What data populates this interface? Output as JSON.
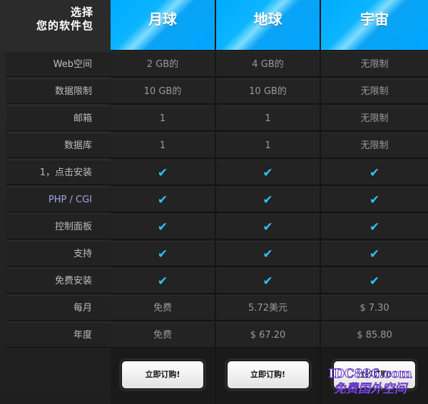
{
  "corner": {
    "line1": "选择",
    "line2": "您的软件包"
  },
  "plans": [
    {
      "name": "月球"
    },
    {
      "name": "地球"
    },
    {
      "name": "宇宙"
    }
  ],
  "rows": [
    {
      "label": "Web空间",
      "values": [
        "2 GB的",
        "4 GB的",
        "无限制"
      ]
    },
    {
      "label": "数据限制",
      "values": [
        "10 GB的",
        "10 GB的",
        "无限制"
      ]
    },
    {
      "label": "邮箱",
      "values": [
        "1",
        "1",
        "无限制"
      ]
    },
    {
      "label": "数据库",
      "values": [
        "1",
        "1",
        "无限制"
      ]
    },
    {
      "label": "1，点击安装",
      "values": [
        "✔",
        "✔",
        "✔"
      ]
    },
    {
      "label": "PHP / CGI",
      "values": [
        "✔",
        "✔",
        "✔"
      ]
    },
    {
      "label": "控制面板",
      "values": [
        "✔",
        "✔",
        "✔"
      ]
    },
    {
      "label": "支持",
      "values": [
        "✔",
        "✔",
        "✔"
      ]
    },
    {
      "label": "免费安装",
      "values": [
        "✔",
        "✔",
        "✔"
      ]
    },
    {
      "label": "每月",
      "values": [
        "免费",
        "5.72美元",
        "$ 7.30"
      ]
    },
    {
      "label": "年度",
      "values": [
        "免费",
        "$ 67.20",
        "$ 85.80"
      ]
    }
  ],
  "buy_label": "立即订购!",
  "watermark": {
    "line1": "IDC886.com",
    "line2": "免费国外空间"
  },
  "colors": {
    "header": "#00aaff",
    "check": "#2ec4ff"
  }
}
